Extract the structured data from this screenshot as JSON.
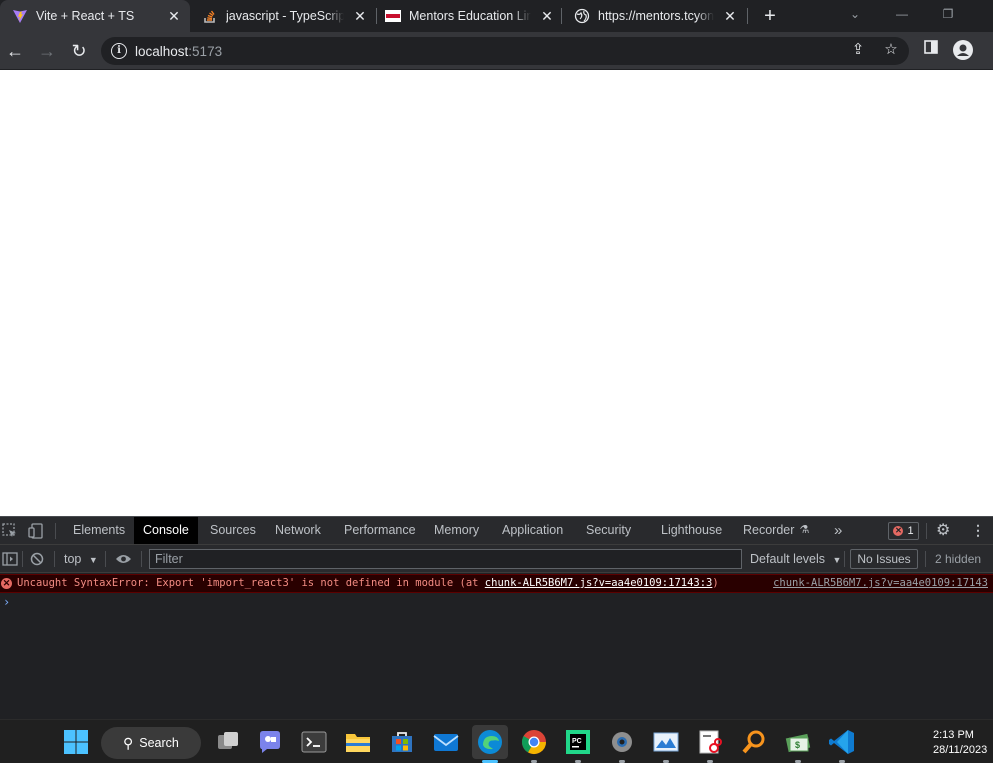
{
  "browser": {
    "tabs": [
      {
        "title": "Vite + React + TS",
        "icon": "vite-logo-icon",
        "active": true
      },
      {
        "title": "javascript - TypeScript error in",
        "icon": "stackoverflow-icon",
        "active": false
      },
      {
        "title": "Mentors Education Limited",
        "icon": "mentors-logo-icon",
        "active": false
      },
      {
        "title": "https://mentors.tcyonline.com",
        "icon": "globe-icon",
        "active": false
      }
    ],
    "new_tab_label": "+",
    "address": {
      "host": "localhost",
      "port": ":5173"
    }
  },
  "devtools": {
    "tabs": [
      "Elements",
      "Console",
      "Sources",
      "Network",
      "Performance",
      "Memory",
      "Application",
      "Security",
      "Lighthouse",
      "Recorder"
    ],
    "active_tab": "Console",
    "more_tabs_label": "»",
    "error_count": "1",
    "console_toolbar": {
      "context": "top",
      "filter_placeholder": "Filter",
      "levels": "Default levels",
      "issues": "No Issues",
      "hidden": "2 hidden"
    },
    "messages": [
      {
        "level": "error",
        "text_before": "Uncaught SyntaxError: Export 'import_react3' is not defined in module (at ",
        "link": "chunk-ALR5B6M7.js?v=aa4e0109:17143:3",
        "text_after": ")",
        "source": "chunk-ALR5B6M7.js?v=aa4e0109:17143"
      }
    ],
    "prompt_symbol": "›"
  },
  "taskbar": {
    "search_label": "Search",
    "time": "2:13 PM",
    "date": "28/11/2023",
    "apps": [
      "start-icon",
      "task-view-icon",
      "chat-icon",
      "terminal-icon",
      "file-explorer-icon",
      "microsoft-store-icon",
      "mail-icon",
      "edge-icon",
      "chrome-icon",
      "pycharm-icon",
      "settings-icon",
      "photos-icon",
      "snipping-tool-icon",
      "search-tool-icon",
      "money-app-icon",
      "vscode-icon"
    ]
  },
  "colors": {
    "tab_bar": "#202124",
    "toolbar": "#35363a",
    "devtools_bg": "#202124",
    "error_text": "#f28b82",
    "taskbar": "#202020"
  }
}
